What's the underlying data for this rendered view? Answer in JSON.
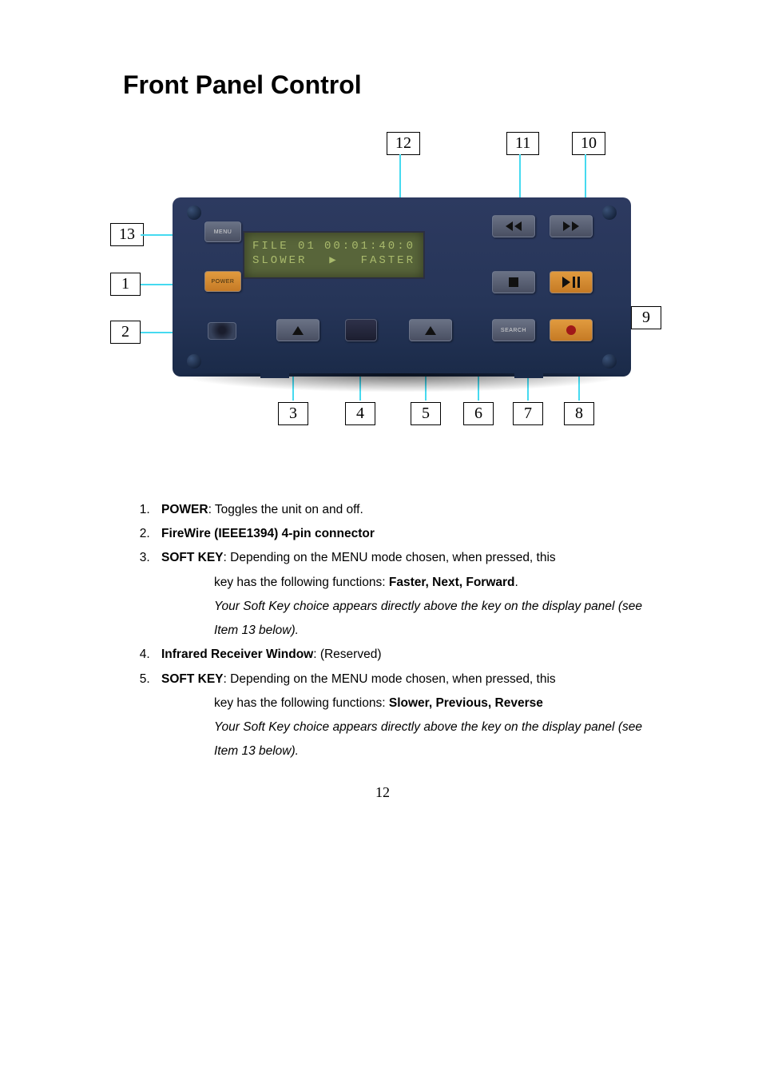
{
  "title": "Front Panel Control",
  "page_number": "12",
  "callouts_top": {
    "c12": "12",
    "c11": "11",
    "c10": "10"
  },
  "callouts_left": {
    "c13": "13",
    "c1": "1",
    "c2": "2"
  },
  "callouts_right": {
    "c9": "9"
  },
  "callouts_bottom": {
    "c3": "3",
    "c4": "4",
    "c5": "5",
    "c6": "6",
    "c7": "7",
    "c8": "8"
  },
  "lcd": {
    "row1_left": "FILE 01",
    "row1_right": "00:01:40:0",
    "row2_left": "SLOWER",
    "row2_mid": "▶",
    "row2_right": "FASTER"
  },
  "button_labels": {
    "menu": "MENU",
    "power": "POWER",
    "search": "SEARCH"
  },
  "list": {
    "i1_bold": "POWER",
    "i1_rest": ": Toggles the unit on and off.",
    "i2_bold": "FireWire (IEEE1394) 4-pin connector",
    "i3_bold": "SOFT KEY",
    "i3_line1": ": Depending on the MENU mode chosen, when pressed, this",
    "i3_line2_pre": "key has the following functions: ",
    "i3_line2_bold": "Faster, Next, Forward",
    "i3_line2_post": ".",
    "i3_line3": "Your Soft Key choice appears directly above the key on the display panel (see Item 13 below).",
    "i4_bold": "Infrared Receiver Window",
    "i4_rest": ": (Reserved)",
    "i5_bold": "SOFT KEY",
    "i5_line1": ": Depending on the MENU mode chosen, when pressed, this",
    "i5_line2_pre": "key has the following functions: ",
    "i5_line2_bold": "Slower, Previous, Reverse",
    "i5_line3": "Your Soft Key choice appears directly above the key on the display panel (see Item 13 below)."
  }
}
